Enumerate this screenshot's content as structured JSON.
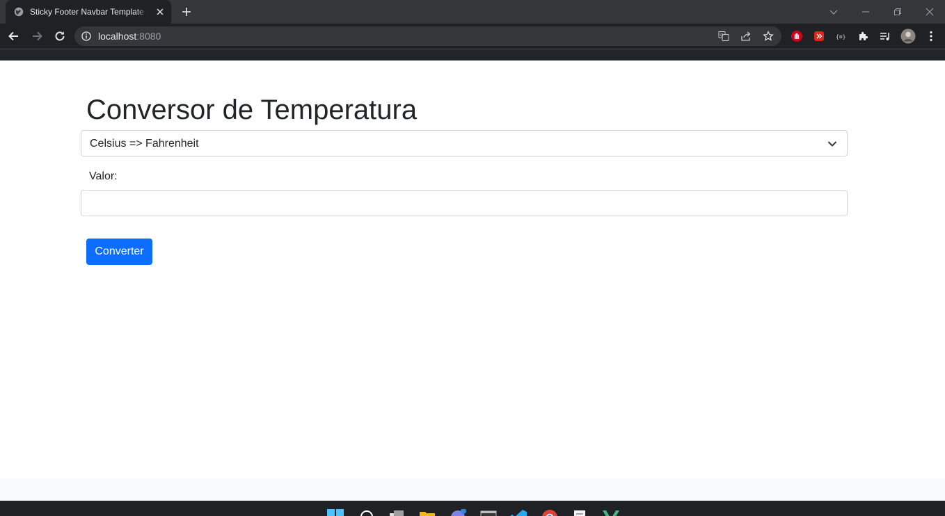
{
  "browser": {
    "tab_title": "Sticky Footer Navbar Template · Bootstrap",
    "url_host": "localhost",
    "url_port": ":8080",
    "icons": [
      "globe-icon",
      "close-icon",
      "plus-icon",
      "back-arrow-icon",
      "forward-arrow-icon",
      "reload-icon",
      "info-icon",
      "translate-icon",
      "share-icon",
      "star-icon",
      "extension-icon",
      "puzzle-icon",
      "media-icon",
      "avatar",
      "kebab-menu-icon"
    ]
  },
  "page": {
    "title": "Conversor de Temperatura",
    "select": {
      "selected": "Celsius => Fahrenheit"
    },
    "value_label": "Valor:",
    "value_input": "",
    "button_label": "Converter"
  },
  "colors": {
    "primary": "#0d6efd",
    "browser_dark": "#202124",
    "navbar": "#212529",
    "footer": "#f8f9fa"
  }
}
